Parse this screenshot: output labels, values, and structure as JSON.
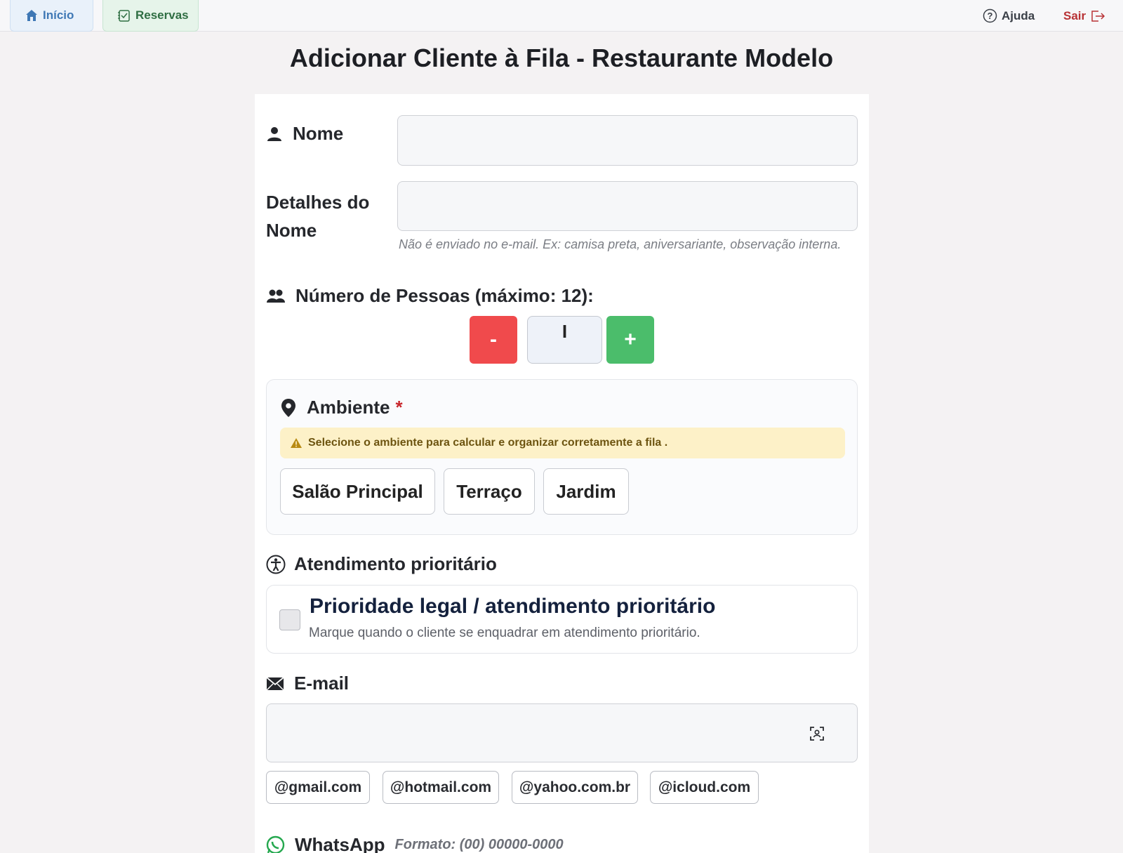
{
  "nav": {
    "inicio": "Início",
    "reservas": "Reservas",
    "ajuda": "Ajuda",
    "sair": "Sair"
  },
  "page_title": "Adicionar Cliente à Fila - Restaurante Modelo",
  "form": {
    "nome_label": "Nome",
    "nome_value": "",
    "detalhes_label_line1": "Detalhes do",
    "detalhes_label_line2": "Nome",
    "detalhes_value": "",
    "detalhes_hint": "Não é enviado no e-mail. Ex: camisa preta, aniversariante, observação interna.",
    "pessoas_label": "Número de Pessoas (máximo: 12):",
    "pessoas_minus": "-",
    "pessoas_plus": "+",
    "pessoas_value": "I",
    "ambiente_label": "Ambiente",
    "ambiente_required": "*",
    "ambiente_warning": "Selecione  o ambiente para calcular e organizar corretamente a fila .",
    "ambiente_options": [
      "Salão Principal",
      "Terraço",
      "Jardim"
    ],
    "prioridade_section": "Atendimento prioritário",
    "prioridade_title": "Prioridade legal / atendimento prioritário",
    "prioridade_sub": "Marque quando o cliente se enquadrar em atendimento prioritário.",
    "prioridade_checked": false,
    "email_label": "E-mail",
    "email_value": "",
    "email_domains": [
      "@gmail.com",
      "@hotmail.com",
      "@yahoo.com.br",
      "@icloud.com"
    ],
    "whatsapp_label": "WhatsApp",
    "whatsapp_format": "Formato: (00) 00000-0000"
  },
  "colors": {
    "minus_btn": "#f04a4c",
    "plus_btn": "#4bbd6b",
    "required": "#c8272d",
    "warning_bg": "#fdf1c8",
    "inicio_text": "#3f78b5",
    "reservas_text": "#2f6e43",
    "sair_text": "#b83236",
    "whatsapp": "#25a84f"
  }
}
